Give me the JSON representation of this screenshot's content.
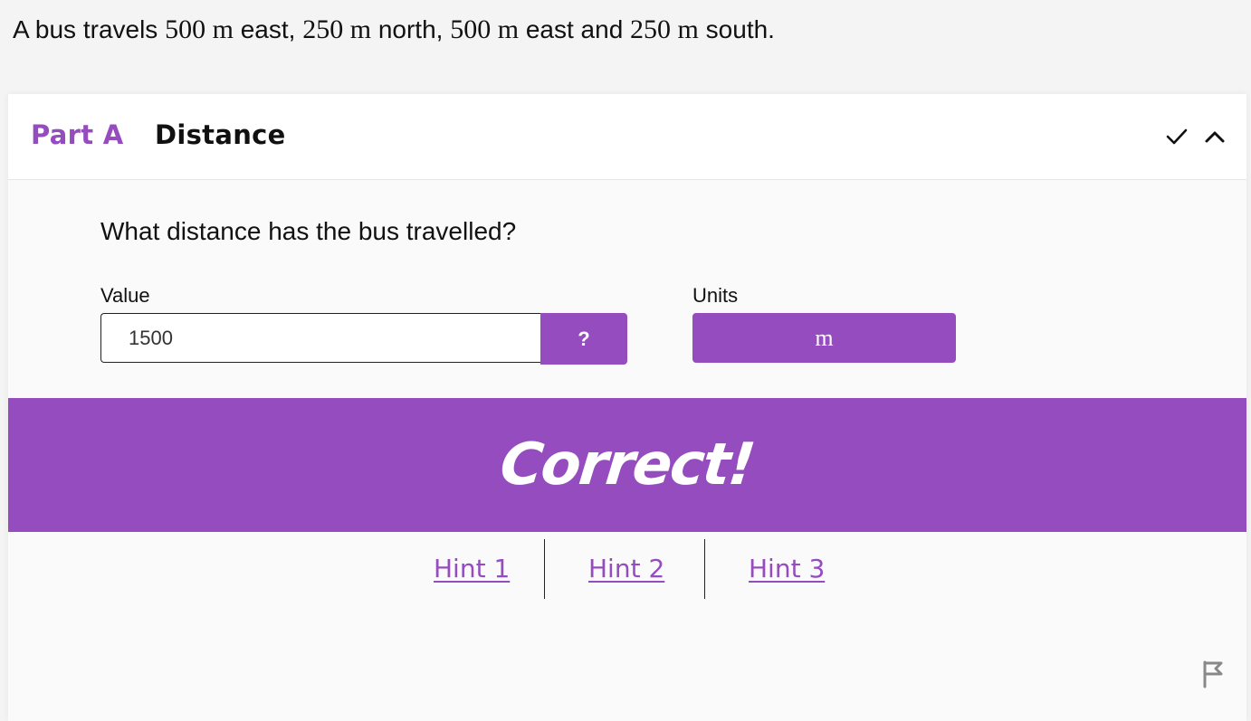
{
  "intro": {
    "t1": "A bus travels ",
    "m1": "500 m",
    "t2": " east, ",
    "m2": "250 m",
    "t3": " north, ",
    "m3": "500 m",
    "t4": " east and ",
    "m4": "250 m",
    "t5": " south."
  },
  "part": {
    "label": "Part A",
    "title": "Distance"
  },
  "header_icons": {
    "status": "check-icon",
    "toggle": "chevron-up-icon"
  },
  "question": "What distance has the bus travelled?",
  "answer": {
    "value_label": "Value",
    "value": "1500",
    "help_label": "?",
    "units_label": "Units",
    "units_value": "m"
  },
  "feedback": {
    "message": "Correct!"
  },
  "hints": [
    "Hint 1",
    "Hint 2",
    "Hint 3"
  ],
  "colors": {
    "accent": "#944cbe",
    "card_bg": "#fafafa",
    "page_bg": "#f4f4f4"
  },
  "footer_icon": "flag-icon"
}
